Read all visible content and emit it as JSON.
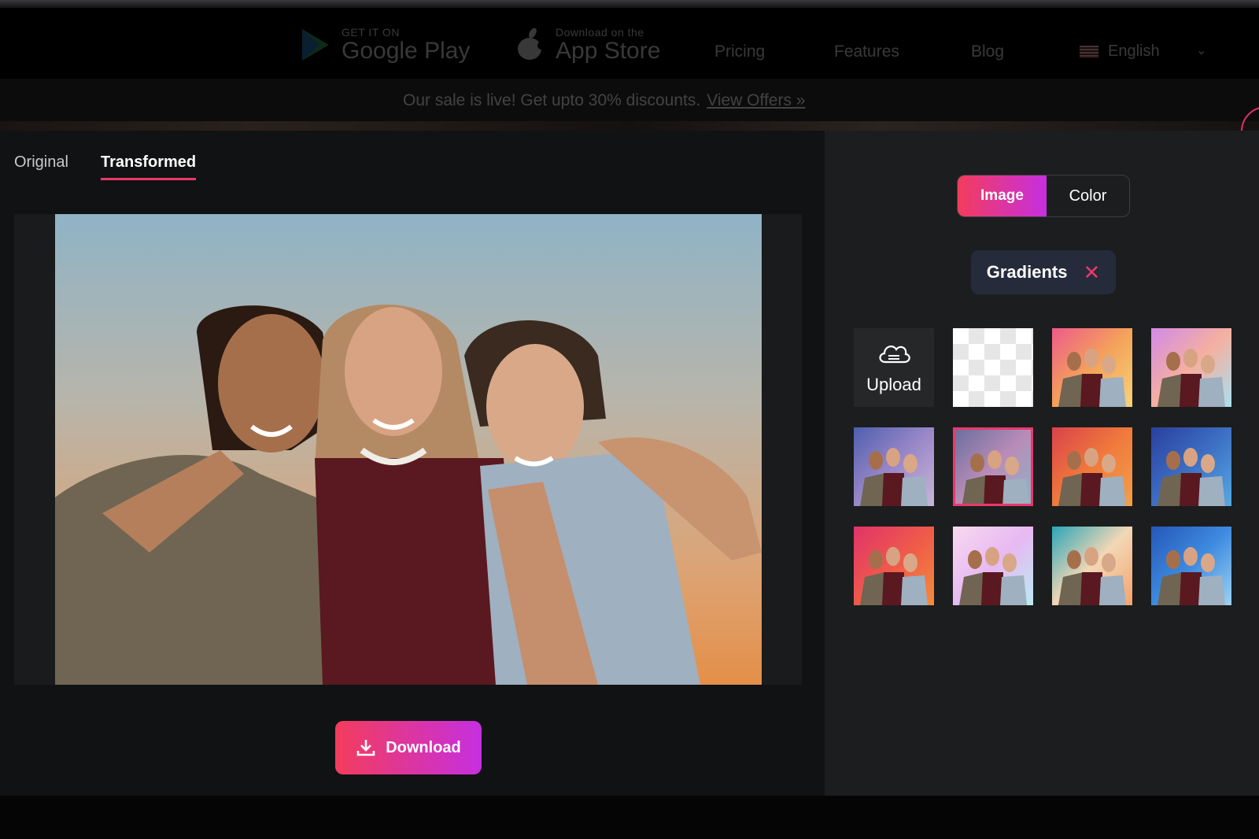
{
  "topnav": {
    "google_play": {
      "small": "GET IT ON",
      "big": "Google Play"
    },
    "app_store": {
      "small": "Download on the",
      "big": "App Store"
    },
    "links": [
      "Pricing",
      "Features",
      "Blog"
    ],
    "language": "English"
  },
  "banner": {
    "text": "Our sale is live! Get upto 30% discounts.",
    "link": "View Offers »"
  },
  "tabs": {
    "original": "Original",
    "transformed": "Transformed",
    "active": "Transformed"
  },
  "download_label": "Download",
  "bg_panel": {
    "mode_image": "Image",
    "mode_color": "Color",
    "active_mode": "Image",
    "category": "Gradients",
    "upload_label": "Upload",
    "gradient_tiles": [
      {
        "colors": [
          "#ee5a8a",
          "#f4a25a",
          "#f6d37a"
        ]
      },
      {
        "colors": [
          "#d28ae6",
          "#f5b0a0",
          "#a9e0ef"
        ]
      },
      {
        "colors": [
          "#4f5fae",
          "#9a88c8",
          "#c8b6d8"
        ]
      },
      {
        "colors": [
          "#6c6f9e",
          "#b88cb8",
          "#8fb3c6"
        ],
        "selected": true
      },
      {
        "colors": [
          "#d9424a",
          "#f07a3c",
          "#f3a04a"
        ]
      },
      {
        "colors": [
          "#2a3f9e",
          "#3d6fc4",
          "#56a9e2"
        ]
      },
      {
        "colors": [
          "#e0336a",
          "#ef5a4a",
          "#f28d3a"
        ]
      },
      {
        "colors": [
          "#f8d9f0",
          "#e7b9f2",
          "#bce9f3"
        ]
      },
      {
        "colors": [
          "#2aa6b8",
          "#f2d7b6",
          "#f5a36a"
        ]
      },
      {
        "colors": [
          "#2557b8",
          "#3e8ae0",
          "#9cd3f2"
        ]
      }
    ]
  },
  "colors": {
    "accent_pink": "#e8396b",
    "gradient_start": "#f33c5c",
    "gradient_end": "#c62fe0",
    "panel_dark": "#111213",
    "panel_right": "#1c1d1f"
  }
}
